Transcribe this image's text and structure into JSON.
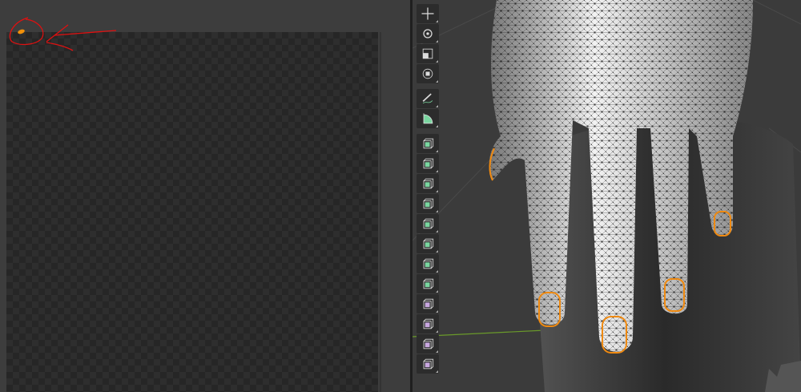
{
  "uv_editor": {
    "annotation_color": "#e01010",
    "island_color": "#f0900a"
  },
  "viewport": {
    "mesh_selection_color": "#f08a10",
    "x_axis_color": "#6a9a2a"
  },
  "toolbar": {
    "tools": [
      {
        "icon": "move-icon",
        "group": 1
      },
      {
        "icon": "rotate-icon",
        "group": 1
      },
      {
        "icon": "scale-icon",
        "group": 1
      },
      {
        "icon": "transform-icon",
        "group": 1
      },
      {
        "icon": "annotate-icon",
        "group": 2
      },
      {
        "icon": "measure-icon",
        "group": 2
      },
      {
        "icon": "add-cube-icon",
        "group": 3
      },
      {
        "icon": "extrude-region-icon",
        "group": 3
      },
      {
        "icon": "inset-faces-icon",
        "group": 3
      },
      {
        "icon": "bevel-icon",
        "group": 3
      },
      {
        "icon": "loop-cut-icon",
        "group": 3
      },
      {
        "icon": "knife-icon",
        "group": 3
      },
      {
        "icon": "poly-build-icon",
        "group": 3
      },
      {
        "icon": "spin-icon",
        "group": 3
      },
      {
        "icon": "smooth-icon",
        "group": 3
      },
      {
        "icon": "edge-slide-icon",
        "group": 3
      },
      {
        "icon": "shrink-fatten-icon",
        "group": 3
      },
      {
        "icon": "shear-icon",
        "group": 3
      }
    ]
  }
}
